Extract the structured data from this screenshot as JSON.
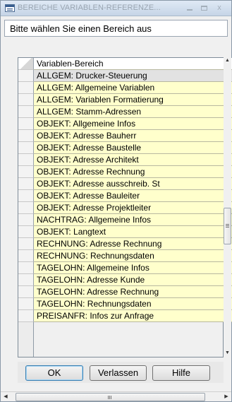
{
  "window": {
    "title": "BEREICHE VARIABLEN-REFERENZE...",
    "minimize_icon": "minimize-icon",
    "maximize_icon": "maximize-icon",
    "close_label": "x"
  },
  "prompt": {
    "text": "Bitte wählen Sie einen Bereich aus"
  },
  "list": {
    "header": "Variablen-Bereich",
    "selected_index": 0,
    "rows": [
      "ALLGEM: Drucker-Steuerung",
      "ALLGEM: Allgemeine Variablen",
      "ALLGEM: Variablen Formatierung",
      "ALLGEM: Stamm-Adressen",
      "OBJEKT: Allgemeine Infos",
      "OBJEKT: Adresse Bauherr",
      "OBJEKT: Adresse Baustelle",
      "OBJEKT: Adresse Architekt",
      "OBJEKT: Adresse Rechnung",
      "OBJEKT: Adresse ausschreib. St",
      "OBJEKT: Adresse Bauleiter",
      "OBJEKT: Adresse Projektleiter",
      "NACHTRAG: Allgemeine Infos",
      "OBJEKT: Langtext",
      "RECHNUNG: Adresse Rechnung",
      "RECHNUNG: Rechnungsdaten",
      "TAGELOHN: Allgemeine Infos",
      "TAGELOHN: Adresse Kunde",
      "TAGELOHN: Adresse Rechnung",
      "TAGELOHN: Rechnungsdaten",
      "PREISANFR: Infos zur Anfrage"
    ]
  },
  "buttons": {
    "ok": "OK",
    "leave": "Verlassen",
    "help": "Hilfe"
  }
}
